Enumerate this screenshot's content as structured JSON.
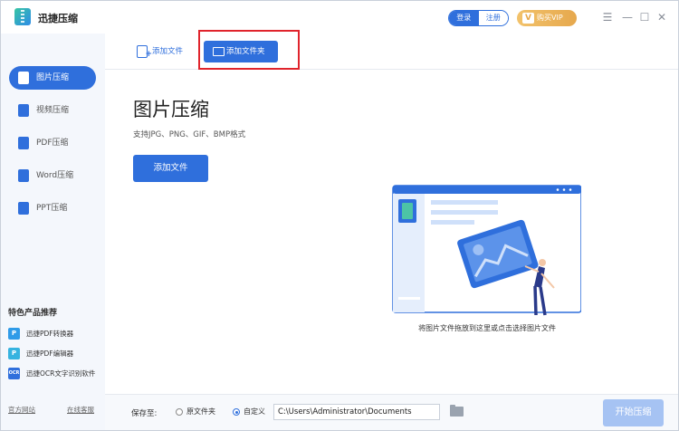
{
  "app": {
    "title": "迅捷压缩"
  },
  "header": {
    "login_label": "登录",
    "register_label": "注册",
    "vip_label": "购买VIP"
  },
  "sidebar": {
    "items": [
      {
        "label": "图片压缩",
        "icon": "image-compress-icon",
        "active": true
      },
      {
        "label": "视频压缩",
        "icon": "video-compress-icon",
        "active": false
      },
      {
        "label": "PDF压缩",
        "icon": "pdf-compress-icon",
        "active": false
      },
      {
        "label": "Word压缩",
        "icon": "word-compress-icon",
        "active": false
      },
      {
        "label": "PPT压缩",
        "icon": "ppt-compress-icon",
        "active": false
      }
    ],
    "featured_title": "特色产品推荐",
    "featured": [
      {
        "label": "迅捷PDF转换器",
        "icon": "pdf-converter-icon",
        "badge": "P"
      },
      {
        "label": "迅捷PDF编辑器",
        "icon": "pdf-editor-icon",
        "badge": "P"
      },
      {
        "label": "迅捷OCR文字识别软件",
        "icon": "ocr-icon",
        "badge": "OCR"
      }
    ],
    "footer_links": [
      "官方网站",
      "在线客服"
    ]
  },
  "toolbar": {
    "add_file_label": "添加文件",
    "add_folder_label": "添加文件夹"
  },
  "main": {
    "title": "图片压缩",
    "subtitle": "支持JPG、PNG、GIF、BMP格式",
    "add_file_button": "添加文件",
    "drop_hint": "将图片文件拖放到这里或点击选择图片文件"
  },
  "bottom": {
    "save_to_label": "保存至:",
    "radio_original": "原文件夹",
    "radio_custom": "自定义",
    "selected": "custom",
    "path_value": "C:\\Users\\Administrator\\Documents",
    "start_button": "开始压缩"
  },
  "colors": {
    "accent": "#2f6fdc",
    "sidebar_bg": "#f4f7fc",
    "vip_gold": "#e6a84d",
    "highlight_red": "#e0242c",
    "disabled_button": "#a6c3f3"
  }
}
